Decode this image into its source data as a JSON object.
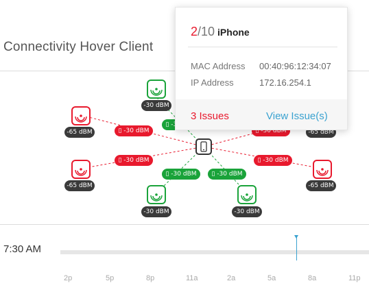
{
  "app": {
    "title": "Connectivity Hover Client"
  },
  "popover": {
    "index": "2",
    "total": "/10",
    "device": "iPhone",
    "rows": [
      {
        "label": "MAC Address",
        "value": "00:40:96:12:34:07"
      },
      {
        "label": "IP Address",
        "value": "172.16.254.1"
      }
    ],
    "issues_label": "3 Issues",
    "view_label": "View Issue(s)",
    "colors": {
      "accent": "#e8192d",
      "link": "#3aa2d0"
    }
  },
  "diagram": {
    "device_icon": "mobile-phone-icon",
    "node_icon": "wifi-access-point-icon",
    "nodes": [
      {
        "id": "top-left",
        "status": "green",
        "signal": "-30 dBM"
      },
      {
        "id": "left-top",
        "status": "red",
        "signal": "-65 dBM"
      },
      {
        "id": "left-bottom",
        "status": "red",
        "signal": "-65 dBM"
      },
      {
        "id": "bottom-left",
        "status": "green",
        "signal": "-30 dBM"
      },
      {
        "id": "bottom-right",
        "status": "green",
        "signal": "-30 dBM"
      },
      {
        "id": "right-bottom",
        "status": "red",
        "signal": "-65 dBM"
      },
      {
        "id": "right-top",
        "status": "red",
        "signal": "-65 dBM"
      }
    ],
    "links": [
      {
        "id": "lt",
        "status": "red",
        "label": "▯ -30 dBM"
      },
      {
        "id": "tl",
        "status": "green",
        "label": "▯ -30 dBM"
      },
      {
        "id": "rt",
        "status": "red",
        "label": "▯ -30 dBM"
      },
      {
        "id": "lb",
        "status": "red",
        "label": "▯ -30 dBM"
      },
      {
        "id": "rb",
        "status": "red",
        "label": "▯ -30 dBM"
      },
      {
        "id": "bl",
        "status": "green",
        "label": "▯ -30 dBM"
      },
      {
        "id": "br",
        "status": "green",
        "label": "▯ -30 dBM"
      }
    ]
  },
  "timeline": {
    "current_time": "7:30 AM",
    "ticks": [
      "2p",
      "5p",
      "8p",
      "11a",
      "2a",
      "5a",
      "8a",
      "11p"
    ]
  }
}
